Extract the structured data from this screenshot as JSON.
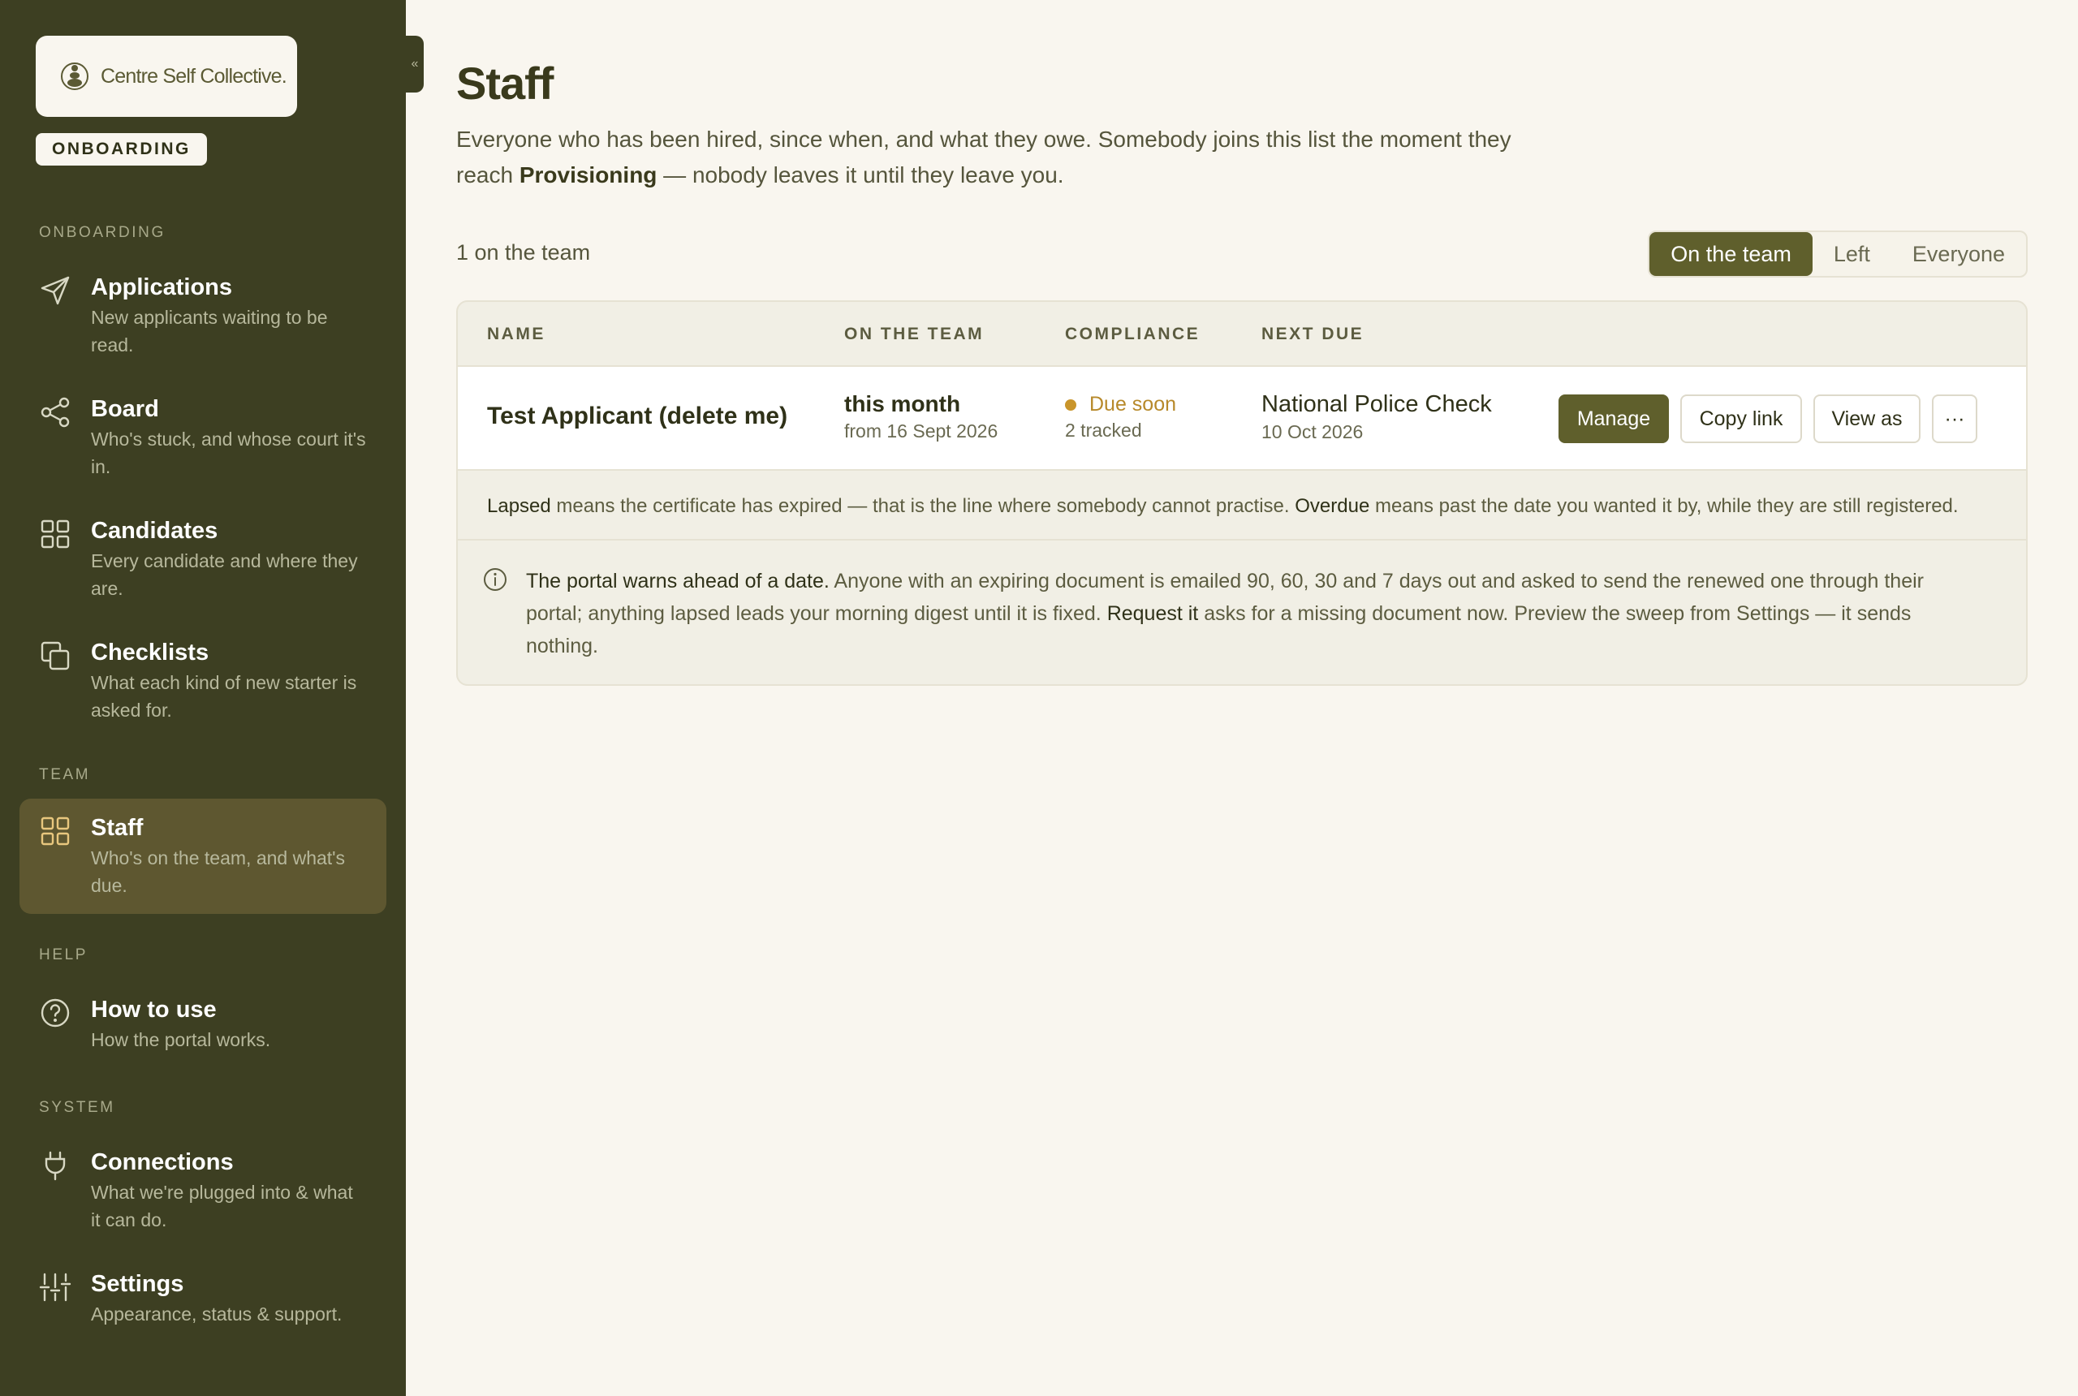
{
  "brand": {
    "name": "Centre Self Collective.",
    "mode_badge": "ONBOARDING"
  },
  "sidebar": {
    "collapse_glyph": "«",
    "sections": [
      {
        "label": "ONBOARDING"
      },
      {
        "label": "TEAM"
      },
      {
        "label": "HELP"
      },
      {
        "label": "SYSTEM"
      }
    ],
    "items": [
      {
        "title": "Applications",
        "desc": "New applicants waiting to be read.",
        "icon": "send-icon"
      },
      {
        "title": "Board",
        "desc": "Who's stuck, and whose court it's in.",
        "icon": "share-icon"
      },
      {
        "title": "Candidates",
        "desc": "Every candidate and where they are.",
        "icon": "grid-icon"
      },
      {
        "title": "Checklists",
        "desc": "What each kind of new starter is asked for.",
        "icon": "copy-icon"
      },
      {
        "title": "Staff",
        "desc": "Who's on the team, and what's due.",
        "icon": "grid-icon",
        "active": true
      },
      {
        "title": "How to use",
        "desc": "How the portal works.",
        "icon": "help-circle-icon"
      },
      {
        "title": "Connections",
        "desc": "What we're plugged into & what it can do.",
        "icon": "plug-icon"
      },
      {
        "title": "Settings",
        "desc": "Appearance, status & support.",
        "icon": "sliders-icon"
      }
    ]
  },
  "main": {
    "title": "Staff",
    "intro_part1": "Everyone who has been hired, since when, and what they owe. Somebody joins this list the moment they reach ",
    "intro_bold": "Provisioning",
    "intro_part2": " — nobody leaves it until they leave you.",
    "count": "1 on the team",
    "filters": [
      "On the team",
      "Left",
      "Everyone"
    ],
    "active_filter": "On the team",
    "table": {
      "headers": [
        "NAME",
        "ON THE TEAM",
        "COMPLIANCE",
        "NEXT DUE"
      ],
      "rows": [
        {
          "name": "Test Applicant (delete me)",
          "on_team": "this month",
          "on_team_sub": "from 16 Sept 2026",
          "status": "Due soon",
          "tracked": "2 tracked",
          "next_due": "National Police Check",
          "next_due_date": "10 Oct 2026",
          "actions": {
            "manage": "Manage",
            "copy": "Copy link",
            "view": "View as",
            "more": "···"
          }
        }
      ]
    },
    "legend": {
      "term1": "Lapsed",
      "text1": " means the certificate has expired — that is the line where somebody cannot practise. ",
      "term2": "Overdue",
      "text2": " means past the date you wanted it by, while they are still registered."
    },
    "info": {
      "lead": "The portal warns ahead of a date.",
      "text1": " Anyone with an expiring document is emailed 90, 60, 30 and 7 days out and asked to send the renewed one through their portal; anything lapsed leads your morning digest until it is fixed. ",
      "term": "Request it",
      "text2": " asks for a missing document now. Preview the sweep from Settings — it sends nothing."
    }
  },
  "colors": {
    "sidebar_bg": "#3d3f22",
    "active_item_bg": "#5e5730",
    "accent": "#5f5f2c",
    "page_bg": "#f9f6ef",
    "status_warn": "#c9952b"
  }
}
